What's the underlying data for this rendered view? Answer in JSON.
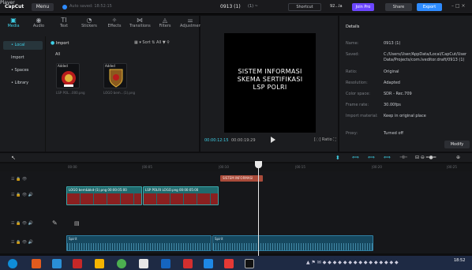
{
  "app": {
    "logo": "CapCut",
    "menu": "Menu",
    "autosave": "Auto saved: 18:52:15",
    "project_title": "0913 (1)",
    "ratio": "(1) ~",
    "shortcut": "Shortcut",
    "user": "92...la",
    "join_pro": "Join Pro",
    "share": "Share",
    "export": "Export",
    "window_controls": "– □ ×"
  },
  "tabs": [
    {
      "label": "Media",
      "icon": "▣"
    },
    {
      "label": "Audio",
      "icon": "◉"
    },
    {
      "label": "Text",
      "icon": "TI"
    },
    {
      "label": "Stickers",
      "icon": "◔"
    },
    {
      "label": "Effects",
      "icon": "✧"
    },
    {
      "label": "Transitions",
      "icon": "⋈"
    },
    {
      "label": "Filters",
      "icon": "◬"
    },
    {
      "label": "Adjustment",
      "icon": "⚌"
    }
  ],
  "sidebar": [
    {
      "label": "• Local"
    },
    {
      "label": "Import"
    },
    {
      "label": "• Spaces"
    },
    {
      "label": "• Library"
    }
  ],
  "media": {
    "import_label": "Import",
    "tools": "▦ ▾  Sort ⇅  All  ▼  ⚲",
    "all_label": "All",
    "items": [
      {
        "added": "Added",
        "name": "LSP POL...000.png"
      },
      {
        "added": "Added",
        "name": "LOGO bem...(1).png"
      }
    ]
  },
  "player": {
    "title": "Player",
    "screen_lines": [
      "SISTEM INFORMASI",
      "SKEMA  SERTIFIKASI",
      "LSP POLRI"
    ],
    "time_current": "00:00:12:15",
    "time_total": "00:00:19:29",
    "right_controls": "[◌]  Ratio  ⛶"
  },
  "details": {
    "title": "Details",
    "rows": [
      {
        "key": "Name:",
        "value": "0913 (1)"
      },
      {
        "key": "Saved:",
        "value": "C:/Users/User/AppData/Local/CapCut/User Data/Projects/com.lveditor.draft/0913 (1)"
      },
      {
        "key": "Ratio:",
        "value": "Original"
      },
      {
        "key": "Resolution:",
        "value": "Adapted"
      },
      {
        "key": "Color space:",
        "value": "SDR - Rec.709"
      },
      {
        "key": "Frame rate:",
        "value": "30.00fps"
      },
      {
        "key": "Import material:",
        "value": "Keep in original place"
      },
      {
        "key": "Proxy:",
        "value": "Turned off"
      }
    ],
    "modify": "Modify"
  },
  "timeline": {
    "ruler": [
      "00:00",
      "|00:05",
      "|00:10",
      "|00:15",
      "|00:20",
      "|00:25"
    ],
    "text_clip": "SISTEM INFORMASI",
    "video_clips": [
      {
        "label": "LOGO bem&bkd-(1).png  00:00:05:00"
      },
      {
        "label": "LSP POLRI LOGO.png  00:00:05:00"
      }
    ],
    "audio_clips": [
      {
        "label": "Spirit"
      },
      {
        "label": "Spirit"
      }
    ]
  },
  "taskbar": {
    "clock": "18:52"
  }
}
